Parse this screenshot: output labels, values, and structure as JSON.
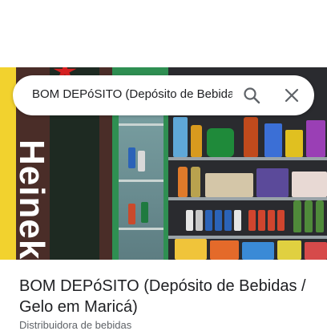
{
  "search": {
    "query": "BOM DEPóSITO (Depósito de Bebidas"
  },
  "photo": {
    "brand_text": "Heineken"
  },
  "place": {
    "title": "BOM DEPóSITO (Depósito de Bebidas / Gelo em Maricá)",
    "category": "Distribuidora de bebidas"
  },
  "icons": {
    "search": "search-icon",
    "close": "close-icon"
  },
  "colors": {
    "title_text": "#202124",
    "secondary_text": "#5f6368",
    "icon": "#5f6368"
  }
}
